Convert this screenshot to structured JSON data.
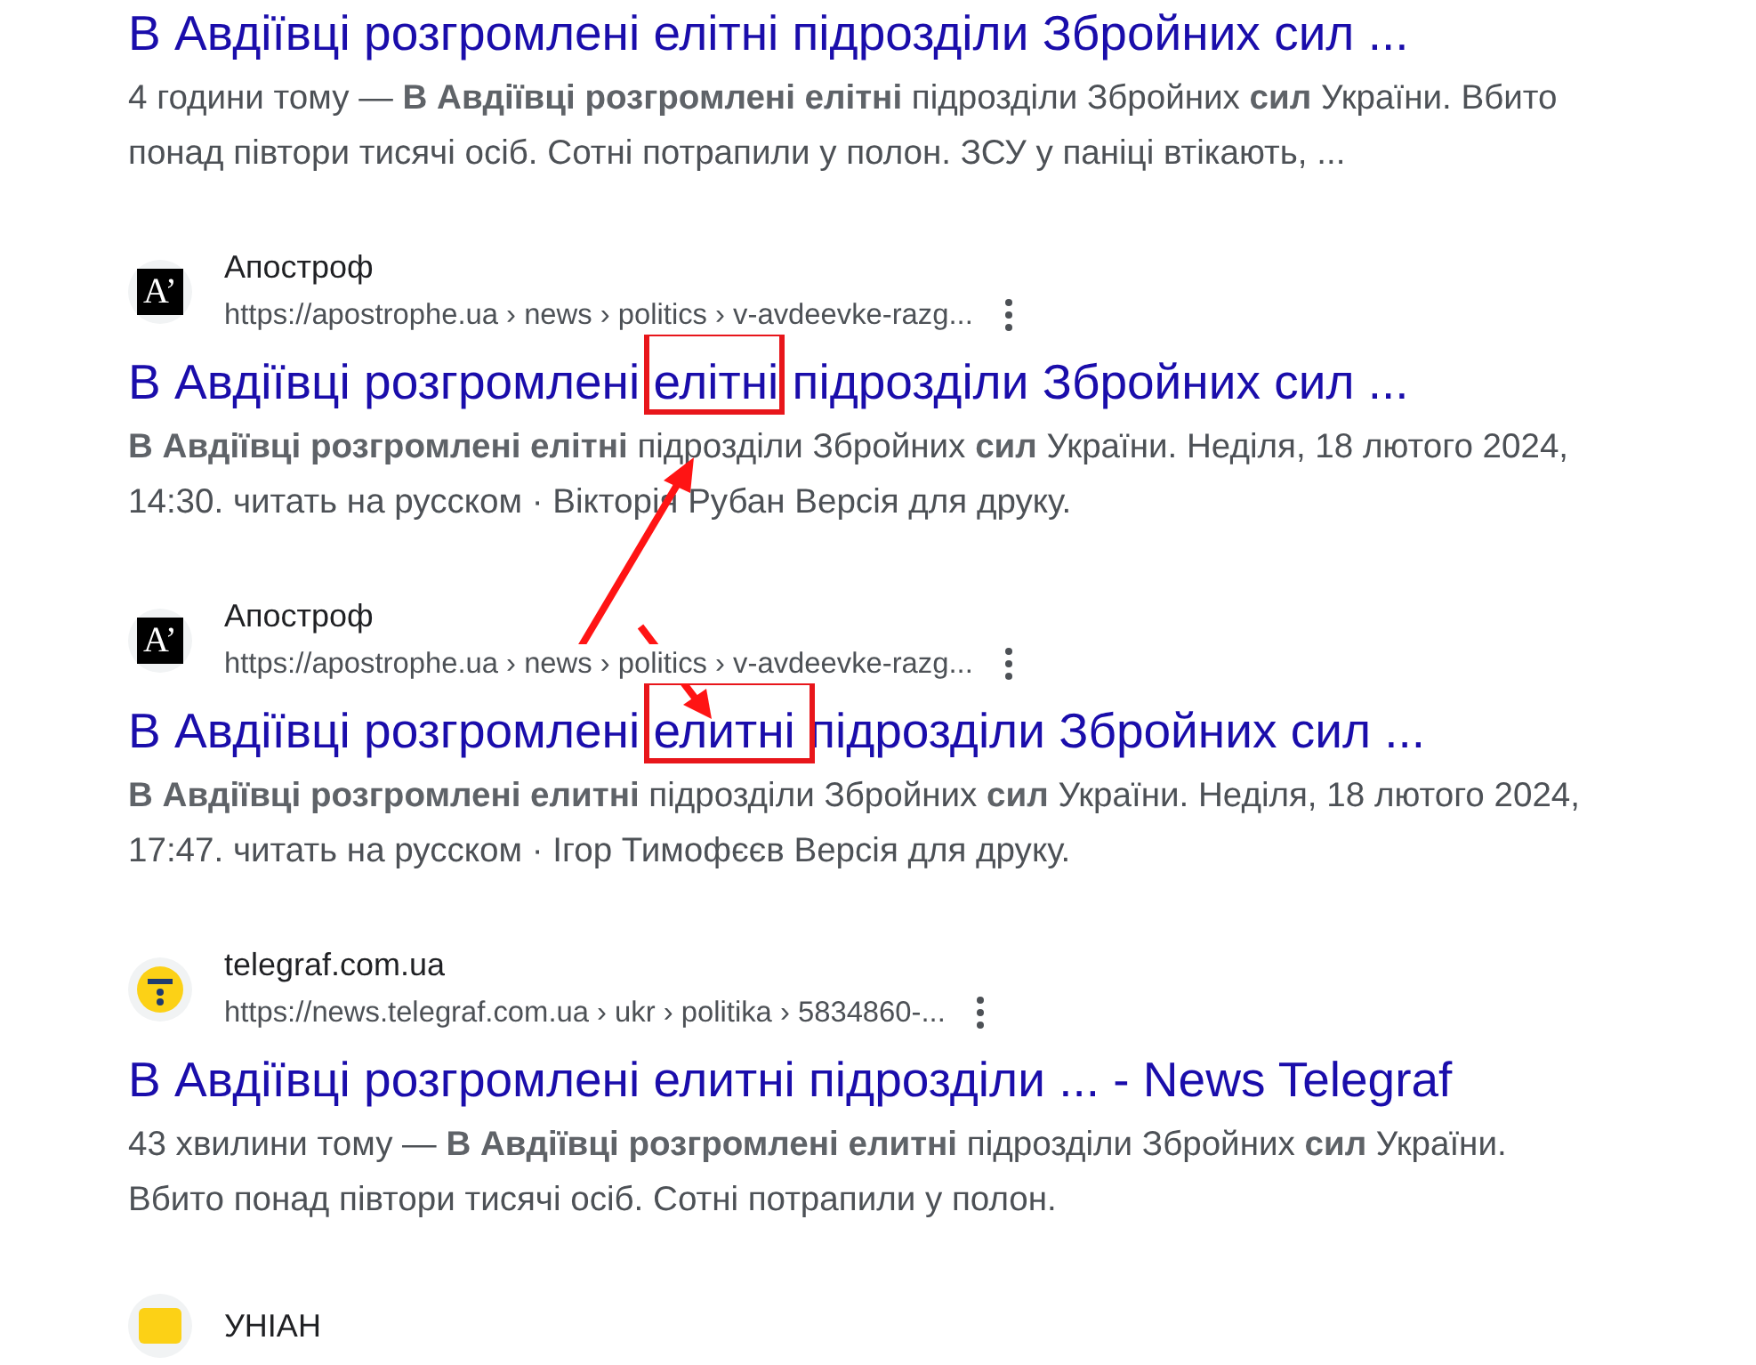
{
  "results": [
    {
      "title": [
        {
          "text": "В Авдіївці розгромлені елітні підрозділи Збройних сил ...",
          "boxed": false
        }
      ],
      "snippet": "4 години тому — **В Авдіївці розгромлені елітні** підрозділи Збройних **сил** України. Вбито понад півтори тисячі осіб. Сотні потрапили у полон. ЗСУ у паніці втікають, ..."
    },
    {
      "site": "Апостроф",
      "url": "https://apostrophe.ua › news › politics › v-avdeevke-razg...",
      "favicon": {
        "kind": "letter",
        "glyph": "A’"
      },
      "title": [
        {
          "text": "В Авдіївці розгромлені ",
          "boxed": false
        },
        {
          "text": "елітні",
          "boxed": true
        },
        {
          "text": " підрозділи Збройних сил ...",
          "boxed": false
        }
      ],
      "snippet": "**В Авдіївці розгромлені елітні** підрозділи Збройних **сил** України. Неділя, 18 лютого 2024, 14:30. читать на русском · Вікторія Рубан Версія для друку."
    },
    {
      "site": "Апостроф",
      "url": "https://apostrophe.ua › news › politics › v-avdeevke-razg...",
      "favicon": {
        "kind": "letter",
        "glyph": "A’"
      },
      "title": [
        {
          "text": "В Авдіївці розгромлені ",
          "boxed": false
        },
        {
          "text": "елитні ",
          "boxed": true
        },
        {
          "text": "підрозділи Збройних сил ...",
          "boxed": false
        }
      ],
      "snippet": "**В Авдіївці розгромлені елитні** підрозділи Збройних **сил** України. Неділя, 18 лютого 2024, 17:47. читать на русском · Ігор Тимофєєв Версія для друку."
    },
    {
      "site": "telegraf.com.ua",
      "url": "https://news.telegraf.com.ua › ukr › politika › 5834860-...",
      "favicon": {
        "kind": "telegraf"
      },
      "title": [
        {
          "text": "В Авдіївці розгромлені елитні підрозділи ... - News Telegraf",
          "boxed": false
        }
      ],
      "snippet": "43 хвилини тому — **В Авдіївці розгромлені елитні** підрозділи Збройних **сил** України. Вбито понад півтори тисячі осіб. Сотні потрапили у полон."
    },
    {
      "site": "УНІАН",
      "favicon": {
        "kind": "yellow"
      }
    }
  ]
}
